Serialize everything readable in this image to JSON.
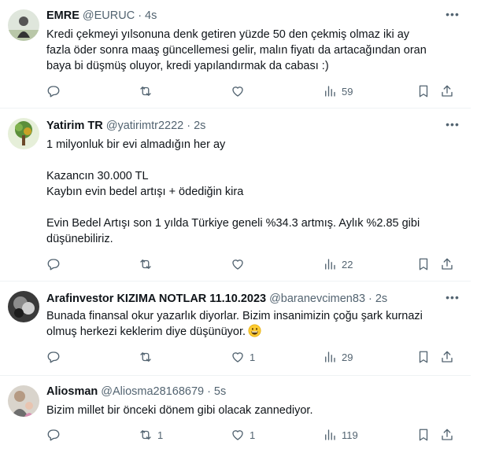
{
  "tweets": [
    {
      "name": "EMRE",
      "handle": "@EURUC",
      "dot": "·",
      "time": "4s",
      "text": "Kredi çekmeyi yılsonuna denk getiren yüzde 50 den çekmiş olmaz iki ay\nfazla öder sonra maaş güncellemesi gelir, malın fiyatı da artacağından oran\nbaya bi düşmüş oluyor, kredi yapılandırmak da cabası :)",
      "views": "59",
      "retweets": "",
      "likes": ""
    },
    {
      "name": "Yatirim TR",
      "handle": "@yatirimtr2222",
      "dot": "·",
      "time": "2s",
      "text": "1 milyonluk bir evi almadığın her ay\n\nKazancın 30.000 TL\nKaybın evin bedel artışı + ödediğin kira\n\nEvin Bedel Artışı son 1 yılda Türkiye geneli %34.3 artmış. Aylık %2.85 gibi\ndüşünebiliriz.",
      "views": "22",
      "retweets": "",
      "likes": ""
    },
    {
      "name": "Arafinvestor KIZIMA NOTLAR 11.10.2023",
      "handle": "@baranevcimen83",
      "dot": "·",
      "time": "2s",
      "text": "Bunada finansal okur yazarlık diyorlar. Bizim insanimizin çoğu şark kurnazi\nolmuş herkezi keklerim diye düşünüyor.",
      "views": "29",
      "retweets": "",
      "likes": "1"
    },
    {
      "name": "Aliosman",
      "handle": "@Aliosma28168679",
      "dot": "·",
      "time": "5s",
      "text": "Bizim millet bir önceki dönem gibi olacak zannediyor.",
      "views": "119",
      "retweets": "1",
      "likes": "1"
    }
  ],
  "icons": {
    "reply": "reply-icon",
    "retweet": "retweet-icon",
    "like": "heart-icon",
    "views": "analytics-icon",
    "bookmark": "bookmark-icon",
    "share": "share-icon",
    "more": "more-icon",
    "emoji": "grinning-face-emoji"
  },
  "colors": {
    "text": "#0f1419",
    "secondary": "#536471",
    "divider": "#eff3f4"
  }
}
